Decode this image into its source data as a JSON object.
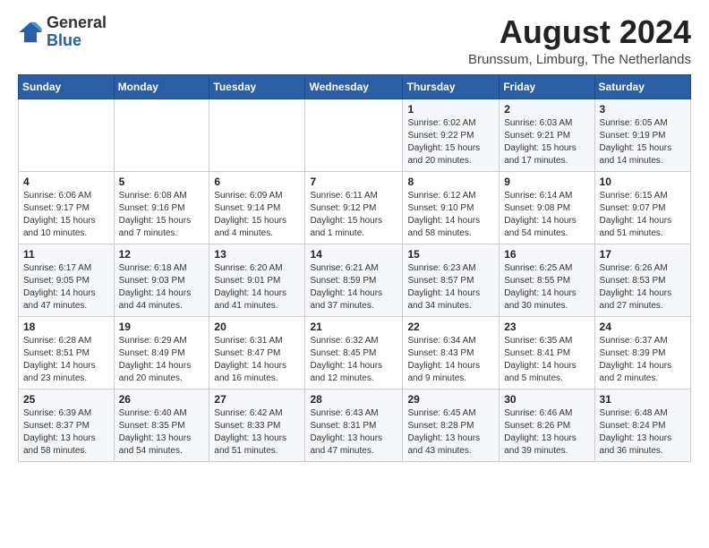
{
  "logo": {
    "general": "General",
    "blue": "Blue"
  },
  "header": {
    "month": "August 2024",
    "location": "Brunssum, Limburg, The Netherlands"
  },
  "days_of_week": [
    "Sunday",
    "Monday",
    "Tuesday",
    "Wednesday",
    "Thursday",
    "Friday",
    "Saturday"
  ],
  "weeks": [
    [
      {
        "day": "",
        "info": ""
      },
      {
        "day": "",
        "info": ""
      },
      {
        "day": "",
        "info": ""
      },
      {
        "day": "",
        "info": ""
      },
      {
        "day": "1",
        "info": "Sunrise: 6:02 AM\nSunset: 9:22 PM\nDaylight: 15 hours\nand 20 minutes."
      },
      {
        "day": "2",
        "info": "Sunrise: 6:03 AM\nSunset: 9:21 PM\nDaylight: 15 hours\nand 17 minutes."
      },
      {
        "day": "3",
        "info": "Sunrise: 6:05 AM\nSunset: 9:19 PM\nDaylight: 15 hours\nand 14 minutes."
      }
    ],
    [
      {
        "day": "4",
        "info": "Sunrise: 6:06 AM\nSunset: 9:17 PM\nDaylight: 15 hours\nand 10 minutes."
      },
      {
        "day": "5",
        "info": "Sunrise: 6:08 AM\nSunset: 9:16 PM\nDaylight: 15 hours\nand 7 minutes."
      },
      {
        "day": "6",
        "info": "Sunrise: 6:09 AM\nSunset: 9:14 PM\nDaylight: 15 hours\nand 4 minutes."
      },
      {
        "day": "7",
        "info": "Sunrise: 6:11 AM\nSunset: 9:12 PM\nDaylight: 15 hours\nand 1 minute."
      },
      {
        "day": "8",
        "info": "Sunrise: 6:12 AM\nSunset: 9:10 PM\nDaylight: 14 hours\nand 58 minutes."
      },
      {
        "day": "9",
        "info": "Sunrise: 6:14 AM\nSunset: 9:08 PM\nDaylight: 14 hours\nand 54 minutes."
      },
      {
        "day": "10",
        "info": "Sunrise: 6:15 AM\nSunset: 9:07 PM\nDaylight: 14 hours\nand 51 minutes."
      }
    ],
    [
      {
        "day": "11",
        "info": "Sunrise: 6:17 AM\nSunset: 9:05 PM\nDaylight: 14 hours\nand 47 minutes."
      },
      {
        "day": "12",
        "info": "Sunrise: 6:18 AM\nSunset: 9:03 PM\nDaylight: 14 hours\nand 44 minutes."
      },
      {
        "day": "13",
        "info": "Sunrise: 6:20 AM\nSunset: 9:01 PM\nDaylight: 14 hours\nand 41 minutes."
      },
      {
        "day": "14",
        "info": "Sunrise: 6:21 AM\nSunset: 8:59 PM\nDaylight: 14 hours\nand 37 minutes."
      },
      {
        "day": "15",
        "info": "Sunrise: 6:23 AM\nSunset: 8:57 PM\nDaylight: 14 hours\nand 34 minutes."
      },
      {
        "day": "16",
        "info": "Sunrise: 6:25 AM\nSunset: 8:55 PM\nDaylight: 14 hours\nand 30 minutes."
      },
      {
        "day": "17",
        "info": "Sunrise: 6:26 AM\nSunset: 8:53 PM\nDaylight: 14 hours\nand 27 minutes."
      }
    ],
    [
      {
        "day": "18",
        "info": "Sunrise: 6:28 AM\nSunset: 8:51 PM\nDaylight: 14 hours\nand 23 minutes."
      },
      {
        "day": "19",
        "info": "Sunrise: 6:29 AM\nSunset: 8:49 PM\nDaylight: 14 hours\nand 20 minutes."
      },
      {
        "day": "20",
        "info": "Sunrise: 6:31 AM\nSunset: 8:47 PM\nDaylight: 14 hours\nand 16 minutes."
      },
      {
        "day": "21",
        "info": "Sunrise: 6:32 AM\nSunset: 8:45 PM\nDaylight: 14 hours\nand 12 minutes."
      },
      {
        "day": "22",
        "info": "Sunrise: 6:34 AM\nSunset: 8:43 PM\nDaylight: 14 hours\nand 9 minutes."
      },
      {
        "day": "23",
        "info": "Sunrise: 6:35 AM\nSunset: 8:41 PM\nDaylight: 14 hours\nand 5 minutes."
      },
      {
        "day": "24",
        "info": "Sunrise: 6:37 AM\nSunset: 8:39 PM\nDaylight: 14 hours\nand 2 minutes."
      }
    ],
    [
      {
        "day": "25",
        "info": "Sunrise: 6:39 AM\nSunset: 8:37 PM\nDaylight: 13 hours\nand 58 minutes."
      },
      {
        "day": "26",
        "info": "Sunrise: 6:40 AM\nSunset: 8:35 PM\nDaylight: 13 hours\nand 54 minutes."
      },
      {
        "day": "27",
        "info": "Sunrise: 6:42 AM\nSunset: 8:33 PM\nDaylight: 13 hours\nand 51 minutes."
      },
      {
        "day": "28",
        "info": "Sunrise: 6:43 AM\nSunset: 8:31 PM\nDaylight: 13 hours\nand 47 minutes."
      },
      {
        "day": "29",
        "info": "Sunrise: 6:45 AM\nSunset: 8:28 PM\nDaylight: 13 hours\nand 43 minutes."
      },
      {
        "day": "30",
        "info": "Sunrise: 6:46 AM\nSunset: 8:26 PM\nDaylight: 13 hours\nand 39 minutes."
      },
      {
        "day": "31",
        "info": "Sunrise: 6:48 AM\nSunset: 8:24 PM\nDaylight: 13 hours\nand 36 minutes."
      }
    ]
  ]
}
